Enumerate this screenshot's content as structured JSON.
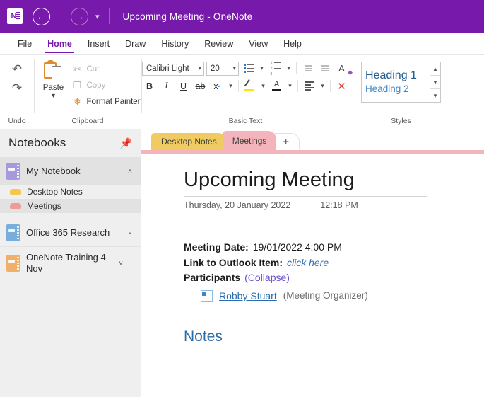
{
  "titlebar": {
    "app_icon": "onenote-icon",
    "back_icon": "back-arrow-icon",
    "forward_icon": "forward-arrow-icon",
    "dropdown_icon": "chevron-down-icon",
    "title": "Upcoming Meeting  -  OneNote",
    "background_color": "#7719aa"
  },
  "ribbon_tabs": [
    {
      "label": "File",
      "active": false
    },
    {
      "label": "Home",
      "active": true
    },
    {
      "label": "Insert",
      "active": false
    },
    {
      "label": "Draw",
      "active": false
    },
    {
      "label": "History",
      "active": false
    },
    {
      "label": "Review",
      "active": false
    },
    {
      "label": "View",
      "active": false
    },
    {
      "label": "Help",
      "active": false
    }
  ],
  "ribbon": {
    "undo": {
      "group_label": "Undo",
      "undo_icon": "undo-arrow-icon",
      "redo_icon": "redo-arrow-icon"
    },
    "clipboard": {
      "group_label": "Clipboard",
      "paste_label": "Paste",
      "cut_label": "Cut",
      "copy_label": "Copy",
      "format_painter_label": "Format Painter"
    },
    "basic_text": {
      "group_label": "Basic Text",
      "font_name": "Calibri Light",
      "font_size": "20",
      "bold_label": "B",
      "italic_label": "I",
      "underline_label": "U",
      "strikethrough_label": "ab",
      "subscript_label": "x",
      "subscript_sub": "2",
      "font_color_letter": "A",
      "clear_formatting_letter": "A"
    },
    "styles": {
      "group_label": "Styles",
      "items": [
        {
          "label": "Heading 1"
        },
        {
          "label": "Heading 2"
        }
      ],
      "scroll_up": "▲",
      "scroll_down": "▼",
      "more": "▼"
    }
  },
  "sidebar": {
    "header": "Notebooks",
    "pin_icon": "pin-icon",
    "notebooks": [
      {
        "name": "My Notebook",
        "color": "#a898dd",
        "expanded": true,
        "caret": "˄",
        "sections": [
          {
            "name": "Desktop Notes",
            "color": "#f5c74c",
            "selected": false
          },
          {
            "name": "Meetings",
            "color": "#f09a9a",
            "selected": true
          }
        ]
      },
      {
        "name": "Office 365 Research",
        "color": "#77aede",
        "expanded": false,
        "caret": "˅",
        "sections": []
      },
      {
        "name": "OneNote Training 4 Nov",
        "color": "#f0b06a",
        "expanded": false,
        "caret": "˅",
        "sections": []
      }
    ]
  },
  "section_tabs": [
    {
      "label": "Desktop Notes",
      "active": false
    },
    {
      "label": "Meetings",
      "active": true
    }
  ],
  "add_tab_label": "+",
  "page": {
    "title": "Upcoming Meeting",
    "date": "Thursday, 20 January 2022",
    "time": "12:18 PM",
    "meeting_date_label": "Meeting Date:",
    "meeting_date_value": "19/01/2022 4:00 PM",
    "outlook_link_label": "Link to Outlook Item:",
    "outlook_link_text": "click here",
    "participants_label": "Participants",
    "participants_toggle": "(Collapse)",
    "participant_name": "Robby Stuart",
    "participant_role": "(Meeting Organizer)",
    "notes_heading": "Notes"
  }
}
